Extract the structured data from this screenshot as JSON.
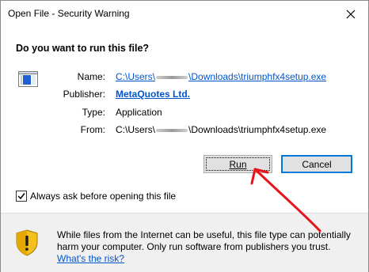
{
  "window": {
    "title": "Open File - Security Warning",
    "close_symbol": "✕"
  },
  "heading": "Do you want to run this file?",
  "fields": {
    "name_label": "Name:",
    "name_prefix": "C:\\Users\\",
    "name_suffix": "\\Downloads\\triumphfx4setup.exe",
    "publisher_label": "Publisher:",
    "publisher_value": "MetaQuotes Ltd.",
    "type_label": "Type:",
    "type_value": "Application",
    "from_label": "From:",
    "from_prefix": "C:\\Users\\",
    "from_suffix": "\\Downloads\\triumphfx4setup.exe"
  },
  "buttons": {
    "run": "Run",
    "cancel": "Cancel"
  },
  "checkbox": {
    "label": "Always ask before opening this file",
    "checked": true
  },
  "footer": {
    "line1": "While files from the Internet can be useful, this file type can potentially",
    "line2": "harm your computer. Only run software from publishers you trust.",
    "link": "What's the risk?"
  },
  "colors": {
    "link": "#0055cc",
    "annotation_arrow": "#e8141b",
    "cancel_focus_border": "#0078d7",
    "shield_yellow": "#f4c020"
  },
  "icons": [
    "close-icon",
    "application-file-icon",
    "checkmark-icon",
    "warning-shield-icon"
  ]
}
